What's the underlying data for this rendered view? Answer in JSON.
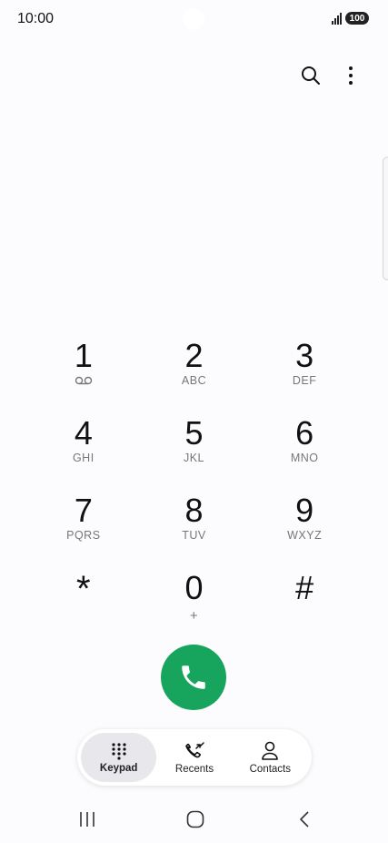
{
  "status_bar": {
    "time": "10:00",
    "battery": "100"
  },
  "icons": {
    "search": "search-icon",
    "more": "more-vert-icon",
    "voicemail": "voicemail-icon",
    "call": "phone-icon",
    "keypad": "dialpad-icon",
    "recents": "recent-calls-icon",
    "contacts": "person-icon"
  },
  "keypad": {
    "keys": [
      {
        "digit": "1",
        "letters": ""
      },
      {
        "digit": "2",
        "letters": "ABC"
      },
      {
        "digit": "3",
        "letters": "DEF"
      },
      {
        "digit": "4",
        "letters": "GHI"
      },
      {
        "digit": "5",
        "letters": "JKL"
      },
      {
        "digit": "6",
        "letters": "MNO"
      },
      {
        "digit": "7",
        "letters": "PQRS"
      },
      {
        "digit": "8",
        "letters": "TUV"
      },
      {
        "digit": "9",
        "letters": "WXYZ"
      },
      {
        "digit": "*",
        "letters": ""
      },
      {
        "digit": "0",
        "letters": "+"
      },
      {
        "digit": "#",
        "letters": ""
      }
    ]
  },
  "bottom_nav": {
    "items": [
      {
        "label": "Keypad",
        "active": true
      },
      {
        "label": "Recents",
        "active": false
      },
      {
        "label": "Contacts",
        "active": false
      }
    ]
  },
  "colors": {
    "call_green": "#17a45c",
    "active_tab_bg": "#e8e8ec"
  }
}
